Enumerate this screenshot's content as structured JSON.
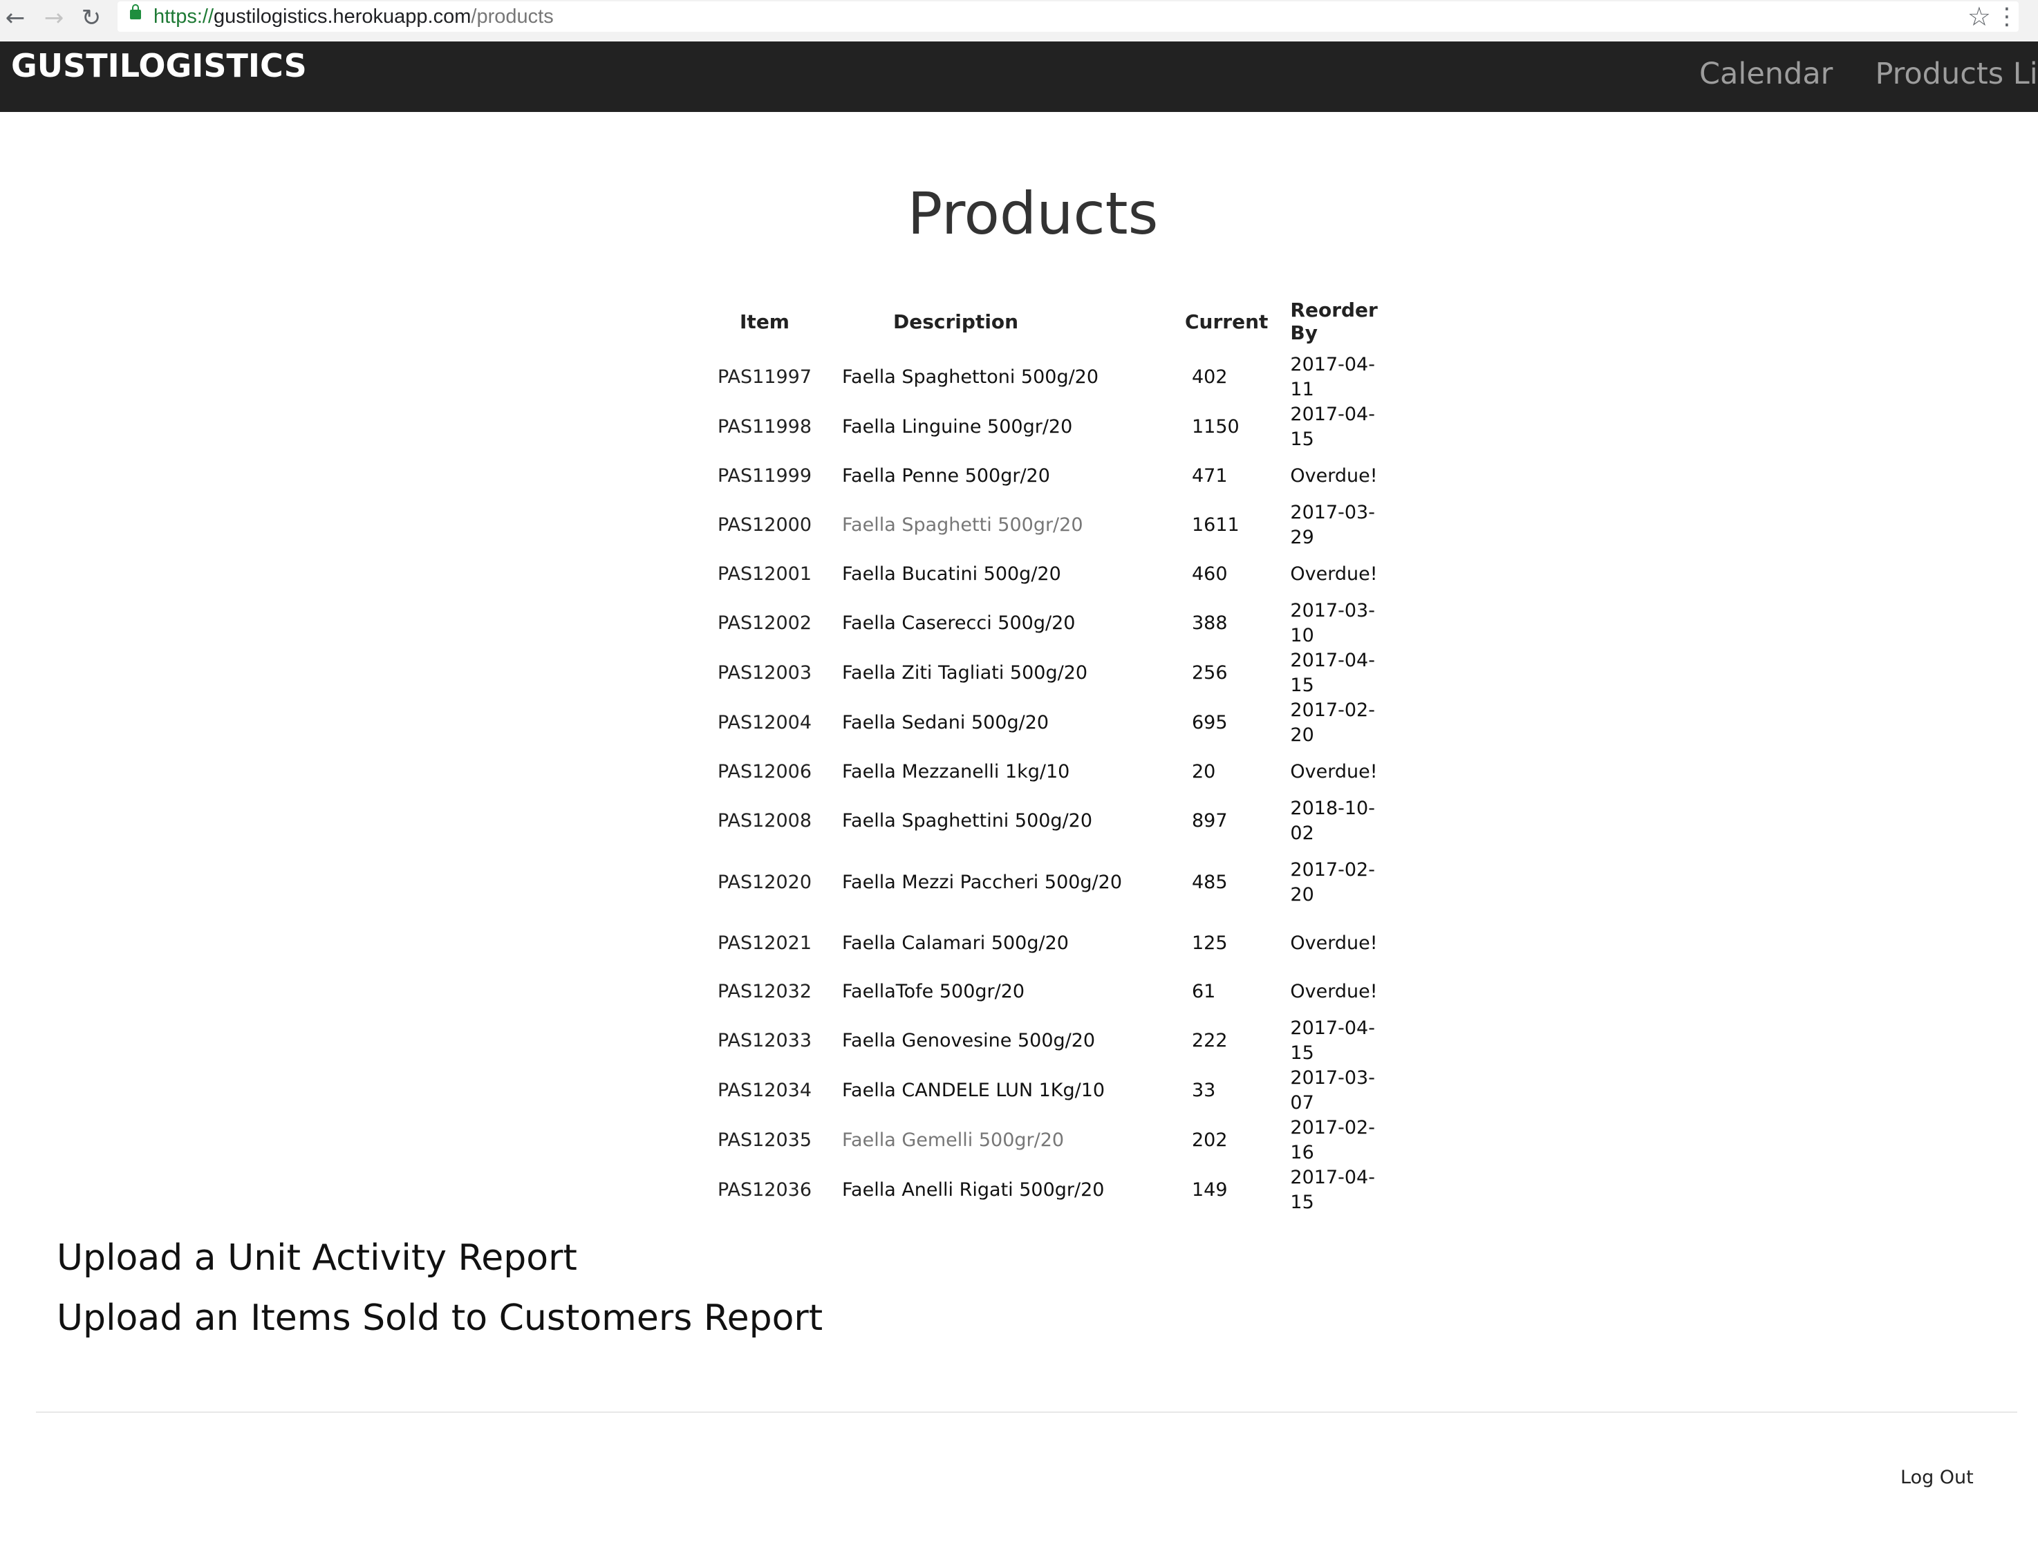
{
  "browser": {
    "back_icon": "←",
    "forward_icon": "→",
    "reload_icon": "↻",
    "url_scheme": "https://",
    "url_host": "gustilogistics.herokuapp.com",
    "url_path": "/products",
    "star_icon": "☆",
    "menu_icon": "⋮"
  },
  "navbar": {
    "brand": "GUSTILOGISTICS",
    "links": [
      "Calendar",
      "Products List"
    ]
  },
  "page": {
    "title": "Products"
  },
  "table": {
    "headers": [
      "Item",
      "Description",
      "Current",
      "Reorder By"
    ],
    "rows": [
      {
        "item": "PAS11997",
        "description": "Faella Spaghettoni 500g/20",
        "current": "402",
        "reorder_by": "2017-04-11"
      },
      {
        "item": "PAS11998",
        "description": "Faella Linguine 500gr/20",
        "current": "1150",
        "reorder_by": "2017-04-15"
      },
      {
        "item": "PAS11999",
        "description": "Faella Penne 500gr/20",
        "current": "471",
        "reorder_by": "Overdue!"
      },
      {
        "item": "PAS12000",
        "description": "Faella Spaghetti 500gr/20",
        "current": "1611",
        "reorder_by": "2017-03-29"
      },
      {
        "item": "PAS12001",
        "description": "Faella Bucatini 500g/20",
        "current": "460",
        "reorder_by": "Overdue!"
      },
      {
        "item": "PAS12002",
        "description": "Faella Caserecci 500g/20",
        "current": "388",
        "reorder_by": "2017-03-10"
      },
      {
        "item": "PAS12003",
        "description": "Faella Ziti Tagliati 500g/20",
        "current": "256",
        "reorder_by": "2017-04-15"
      },
      {
        "item": "PAS12004",
        "description": "Faella Sedani 500g/20",
        "current": "695",
        "reorder_by": "2017-02-20"
      },
      {
        "item": "PAS12006",
        "description": "Faella Mezzanelli 1kg/10",
        "current": "20",
        "reorder_by": "Overdue!"
      },
      {
        "item": "PAS12008",
        "description": "Faella Spaghettini 500g/20",
        "current": "897",
        "reorder_by": "2018-10-02"
      },
      {
        "item": "PAS12020",
        "description": "Faella Mezzi Paccheri 500g/20",
        "current": "485",
        "reorder_by": "2017-02-20"
      },
      {
        "item": "PAS12021",
        "description": "Faella Calamari 500g/20",
        "current": "125",
        "reorder_by": "Overdue!"
      },
      {
        "item": "PAS12032",
        "description": "FaellaTofe 500gr/20",
        "current": "61",
        "reorder_by": "Overdue!"
      },
      {
        "item": "PAS12033",
        "description": "Faella Genovesine 500g/20",
        "current": "222",
        "reorder_by": "2017-04-15"
      },
      {
        "item": "PAS12034",
        "description": "Faella CANDELE LUN 1Kg/10",
        "current": "33",
        "reorder_by": "2017-03-07"
      },
      {
        "item": "PAS12035",
        "description": "Faella Gemelli 500gr/20",
        "current": "202",
        "reorder_by": "2017-02-16"
      },
      {
        "item": "PAS12036",
        "description": "Faella Anelli Rigati 500gr/20",
        "current": "149",
        "reorder_by": "2017-04-15"
      }
    ]
  },
  "uploads": {
    "unit_activity": "Upload a Unit Activity Report",
    "items_sold": "Upload an Items Sold to Customers Report"
  },
  "footer": {
    "logout": "Log Out"
  }
}
